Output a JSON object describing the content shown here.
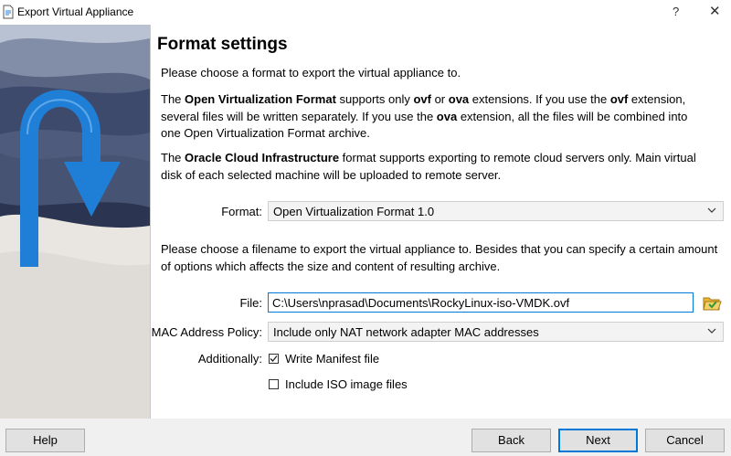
{
  "window": {
    "title": "Export Virtual Appliance",
    "help_glyph": "?",
    "close_glyph": "✕"
  },
  "page": {
    "heading": "Format settings",
    "intro": "Please choose a format to export the virtual appliance to.",
    "ovf_para": {
      "p1": "The ",
      "b1": "Open Virtualization Format",
      "p2": " supports only ",
      "b2": "ovf",
      "p3": " or ",
      "b3": "ova",
      "p4": " extensions. If you use the ",
      "b4": "ovf",
      "p5": " extension, several files will be written separately. If you use the ",
      "b5": "ova",
      "p6": " extension, all the files will be combined into one Open Virtualization Format archive."
    },
    "oci_para": {
      "p1": "The ",
      "b1": "Oracle Cloud Infrastructure",
      "p2": " format supports exporting to remote cloud servers only. Main virtual disk of each selected machine will be uploaded to remote server."
    },
    "format": {
      "label": "Format:",
      "value": "Open Virtualization Format 1.0"
    },
    "filename_para": "Please choose a filename to export the virtual appliance to. Besides that you can specify a certain amount of options which affects the size and content of resulting archive.",
    "file": {
      "label": "File:",
      "value": "C:\\Users\\nprasad\\Documents\\RockyLinux-iso-VMDK.ovf"
    },
    "mac_policy": {
      "label": "MAC Address Policy:",
      "value": "Include only NAT network adapter MAC addresses"
    },
    "additionally": {
      "label": "Additionally:",
      "manifest": {
        "label": "Write Manifest file",
        "checked": true
      },
      "iso": {
        "label": "Include ISO image files",
        "checked": false
      }
    }
  },
  "footer": {
    "help": "Help",
    "back": "Back",
    "next": "Next",
    "cancel": "Cancel"
  },
  "colors": {
    "accent": "#0078d7",
    "arrow": "#1f7fd6",
    "side_bg": "#2b3552"
  }
}
